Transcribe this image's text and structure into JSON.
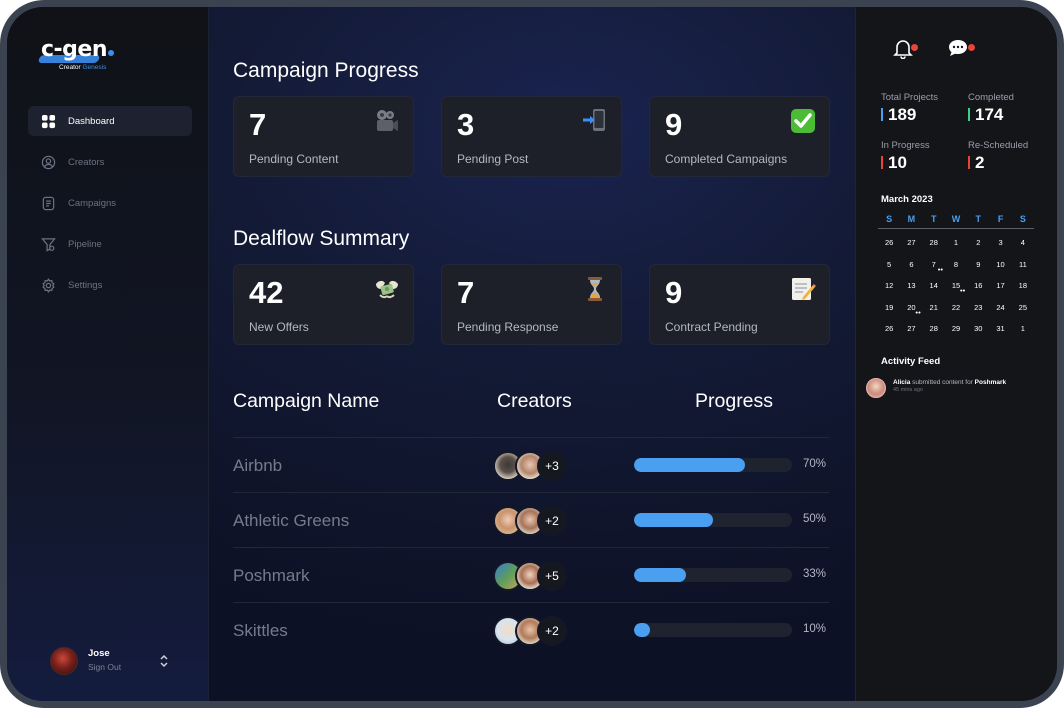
{
  "app": {
    "logo_text": "c-gen",
    "logo_sub_1": "Creator",
    "logo_sub_2": "Genesis"
  },
  "sidebar": {
    "items": [
      {
        "label": "Dashboard",
        "icon": "grid-icon",
        "active": true
      },
      {
        "label": "Creators",
        "icon": "user-circle-icon"
      },
      {
        "label": "Campaigns",
        "icon": "document-icon"
      },
      {
        "label": "Pipeline",
        "icon": "funnel-icon"
      },
      {
        "label": "Settings",
        "icon": "gear-icon"
      }
    ],
    "user": {
      "name": "Jose",
      "sub": "Sign Out"
    }
  },
  "campaign_progress": {
    "title": "Campaign Progress",
    "cards": [
      {
        "value": "7",
        "label": "Pending Content",
        "icon": "video-camera-icon"
      },
      {
        "value": "3",
        "label": "Pending Post",
        "icon": "mobile-arrow-icon"
      },
      {
        "value": "9",
        "label": "Completed Campaigns",
        "icon": "check-mark-icon"
      }
    ]
  },
  "dealflow": {
    "title": "Dealflow Summary",
    "cards": [
      {
        "value": "42",
        "label": "New Offers",
        "icon": "money-wings-icon"
      },
      {
        "value": "7",
        "label": "Pending Response",
        "icon": "hourglass-icon"
      },
      {
        "value": "9",
        "label": "Contract Pending",
        "icon": "memo-icon"
      }
    ]
  },
  "table": {
    "headers": [
      "Campaign Name",
      "Creators",
      "Progress"
    ],
    "rows": [
      {
        "name": "Airbnb",
        "more": "+3",
        "progress": 70,
        "progress_label": "70%"
      },
      {
        "name": "Athletic Greens",
        "more": "+2",
        "progress": 50,
        "progress_label": "50%"
      },
      {
        "name": "Poshmark",
        "more": "+5",
        "progress": 33,
        "progress_label": "33%"
      },
      {
        "name": "Skittles",
        "more": "+2",
        "progress": 10,
        "progress_label": "10%"
      }
    ]
  },
  "right_panel": {
    "stats": [
      {
        "label": "Total Projects",
        "value": "189",
        "color": "#4a9ff0"
      },
      {
        "label": "Completed",
        "value": "174",
        "color": "#3ecf8e"
      },
      {
        "label": "In Progress",
        "value": "10",
        "color": "#e8443a"
      },
      {
        "label": "Re-Scheduled",
        "value": "2",
        "color": "#e8443a"
      }
    ],
    "calendar": {
      "title": "March 2023",
      "weekdays": [
        "S",
        "M",
        "T",
        "W",
        "T",
        "F",
        "S"
      ],
      "days": [
        {
          "d": "26",
          "dim": true
        },
        {
          "d": "27",
          "dim": true
        },
        {
          "d": "28",
          "dim": true
        },
        {
          "d": "1"
        },
        {
          "d": "2"
        },
        {
          "d": "3"
        },
        {
          "d": "4"
        },
        {
          "d": "5"
        },
        {
          "d": "6"
        },
        {
          "d": "7",
          "marks": [
            "red",
            "blue"
          ]
        },
        {
          "d": "8"
        },
        {
          "d": "9"
        },
        {
          "d": "10"
        },
        {
          "d": "11"
        },
        {
          "d": "12"
        },
        {
          "d": "13"
        },
        {
          "d": "14"
        },
        {
          "d": "15",
          "marks": [
            "blue",
            "blue"
          ]
        },
        {
          "d": "16"
        },
        {
          "d": "17"
        },
        {
          "d": "18"
        },
        {
          "d": "19"
        },
        {
          "d": "20",
          "marks": [
            "red",
            "blue"
          ]
        },
        {
          "d": "21"
        },
        {
          "d": "22"
        },
        {
          "d": "23"
        },
        {
          "d": "24"
        },
        {
          "d": "25"
        },
        {
          "d": "26"
        },
        {
          "d": "27"
        },
        {
          "d": "28"
        },
        {
          "d": "29"
        },
        {
          "d": "30"
        },
        {
          "d": "31"
        },
        {
          "d": "1",
          "dim": true
        }
      ]
    },
    "feed": {
      "title": "Activity Feed",
      "items": [
        {
          "user": "Alicia",
          "action": "submitted content for",
          "target": "Poshmark",
          "time": "45 mins ago"
        }
      ]
    }
  }
}
